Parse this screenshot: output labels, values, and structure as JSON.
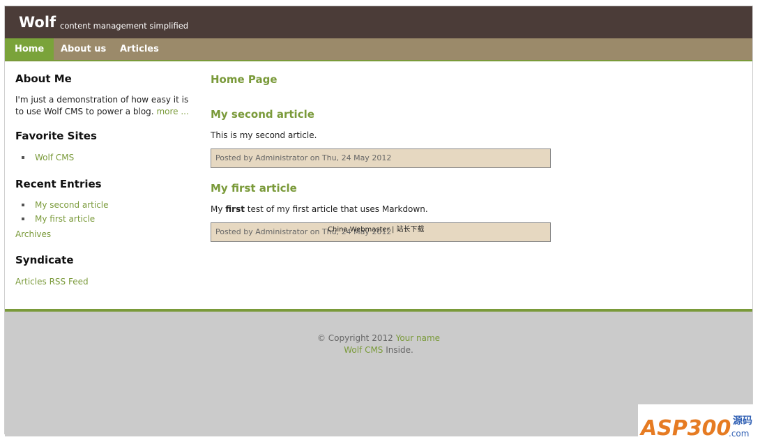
{
  "header": {
    "logo": "Wolf",
    "tagline": "content management simplified"
  },
  "nav": {
    "items": [
      "Home",
      "About us",
      "Articles"
    ]
  },
  "sidebar": {
    "about_title": "About Me",
    "about_text": "I'm just a demonstration of how easy it is to use Wolf CMS to power a blog.",
    "about_more": "more ...",
    "favorites_title": "Favorite Sites",
    "favorites": [
      "Wolf CMS"
    ],
    "recent_title": "Recent Entries",
    "recent": [
      "My second article",
      "My first article"
    ],
    "archives": "Archives",
    "syndicate_title": "Syndicate",
    "rss": "Articles RSS Feed"
  },
  "main": {
    "page_title": "Home Page",
    "articles": [
      {
        "title": "My second article",
        "body": "This is my second article.",
        "info": "Posted by Administrator on Thu, 24 May 2012"
      },
      {
        "title": "My first article",
        "body_prefix": "My ",
        "body_bold": "first",
        "body_suffix": " test of my first article that uses Markdown.",
        "info": "Posted by Administrator on Thu, 24 May 2012"
      }
    ]
  },
  "footer": {
    "copyright": "© Copyright 2012",
    "your_name": "Your name",
    "wolf_cms": "Wolf CMS",
    "inside": "Inside."
  },
  "overlay": {
    "watermark": "China Webmaster | 站长下载",
    "asp_logo_text": "ASP300",
    "asp_logo_suffix": "源码",
    "asp_logo_domain": ".com"
  }
}
